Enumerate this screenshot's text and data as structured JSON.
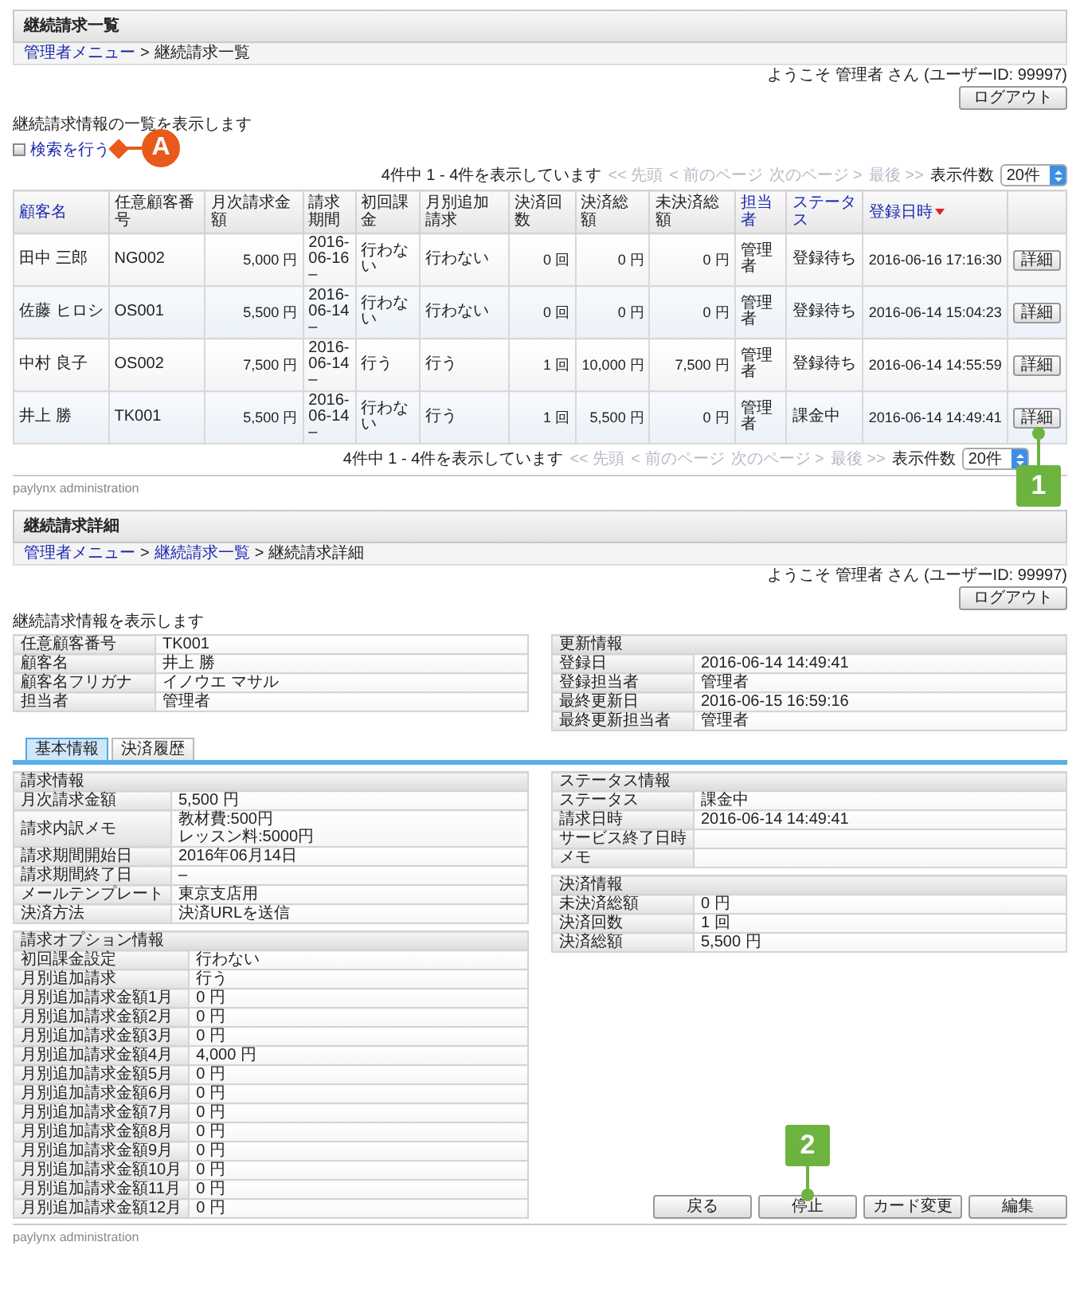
{
  "list_page": {
    "title": "継続請求一覧",
    "separator": ">",
    "breadcrumb": [
      {
        "label": "管理者メニュー",
        "link": true
      },
      {
        "label": "継続請求一覧",
        "link": false
      }
    ],
    "welcome": "ようこそ 管理者 さん (ユーザーID: 99997)",
    "logout": "ログアウト",
    "intro": "継続請求情報の一覧を表示します",
    "search": {
      "label": "検索を行う",
      "annotation": {
        "label": "A",
        "kind": "circle"
      }
    },
    "pagers": [
      {
        "summary": "4件中 1 - 4件を表示しています",
        "links": [
          {
            "label": "<< 先頭",
            "disabled": true
          },
          {
            "label": "< 前のページ",
            "disabled": true
          },
          {
            "label": "次のページ >",
            "disabled": true
          },
          {
            "label": "最後 >>",
            "disabled": true
          }
        ],
        "per_page_label": "表示件数",
        "per_page": "20件"
      },
      {
        "summary": "4件中 1 - 4件を表示しています",
        "links": [
          {
            "label": "<< 先頭",
            "disabled": true
          },
          {
            "label": "< 前のページ",
            "disabled": true
          },
          {
            "label": "次のページ >",
            "disabled": true
          },
          {
            "label": "最後 >>",
            "disabled": true
          }
        ],
        "per_page_label": "表示件数",
        "per_page": "20件"
      }
    ],
    "table": {
      "columns": [
        {
          "label": "顧客名",
          "sortable": true,
          "sorted": false,
          "numeric": false
        },
        {
          "label": "任意顧客番号",
          "sortable": false,
          "sorted": false,
          "numeric": false
        },
        {
          "label": "月次請求金額",
          "sortable": false,
          "sorted": false,
          "numeric": true
        },
        {
          "label": "請求期間",
          "sortable": false,
          "sorted": false,
          "numeric": false
        },
        {
          "label": "初回課金",
          "sortable": false,
          "sorted": false,
          "numeric": false
        },
        {
          "label": "月別追加請求",
          "sortable": false,
          "sorted": false,
          "numeric": false
        },
        {
          "label": "決済回数",
          "sortable": false,
          "sorted": false,
          "numeric": true
        },
        {
          "label": "決済総額",
          "sortable": false,
          "sorted": false,
          "numeric": true
        },
        {
          "label": "未決済総額",
          "sortable": false,
          "sorted": false,
          "numeric": true
        },
        {
          "label": "担当者",
          "sortable": true,
          "sorted": false,
          "numeric": false
        },
        {
          "label": "ステータス",
          "sortable": true,
          "sorted": false,
          "numeric": false
        },
        {
          "label": "登録日時",
          "sortable": true,
          "sorted": true,
          "numeric": false
        }
      ],
      "rows": [
        {
          "cells": [
            "田中 三郎",
            "NG002",
            "5,000 円",
            "2016-06-16 –",
            "行わない",
            "行わない",
            "0 回",
            "0 円",
            "0 円",
            "管理者",
            "登録待ち",
            "2016-06-16 17:16:30"
          ],
          "action": "詳細"
        },
        {
          "cells": [
            "佐藤 ヒロシ",
            "OS001",
            "5,500 円",
            "2016-06-14 –",
            "行わない",
            "行わない",
            "0 回",
            "0 円",
            "0 円",
            "管理者",
            "登録待ち",
            "2016-06-14 15:04:23"
          ],
          "action": "詳細"
        },
        {
          "cells": [
            "中村 良子",
            "OS002",
            "7,500 円",
            "2016-06-14 –",
            "行う",
            "行う",
            "1 回",
            "10,000 円",
            "7,500 円",
            "管理者",
            "登録待ち",
            "2016-06-14 14:55:59"
          ],
          "action": "詳細"
        },
        {
          "cells": [
            "井上 勝",
            "TK001",
            "5,500 円",
            "2016-06-14 –",
            "行わない",
            "行う",
            "1 回",
            "5,500 円",
            "0 円",
            "管理者",
            "課金中",
            "2016-06-14 14:49:41"
          ],
          "action": "詳細"
        }
      ]
    },
    "annotation": {
      "label": "1",
      "kind": "flag"
    },
    "footer": "paylynx administration"
  },
  "detail_page": {
    "title": "継続請求詳細",
    "separator": ">",
    "breadcrumb": [
      {
        "label": "管理者メニュー",
        "link": true
      },
      {
        "label": "継続請求一覧",
        "link": true
      },
      {
        "label": "継続請求詳細",
        "link": false
      }
    ],
    "welcome": "ようこそ 管理者 さん (ユーザーID: 99997)",
    "logout": "ログアウト",
    "intro": "継続請求情報を表示します",
    "customer": {
      "rows": [
        {
          "label": "任意顧客番号",
          "value": "TK001"
        },
        {
          "label": "顧客名",
          "value": "井上 勝"
        },
        {
          "label": "顧客名フリガナ",
          "value": "イノウエ マサル"
        },
        {
          "label": "担当者",
          "value": "管理者"
        }
      ]
    },
    "update_info": {
      "title": "更新情報",
      "rows": [
        {
          "label": "登録日",
          "value": "2016-06-14 14:49:41"
        },
        {
          "label": "登録担当者",
          "value": "管理者"
        },
        {
          "label": "最終更新日",
          "value": "2016-06-15 16:59:16"
        },
        {
          "label": "最終更新担当者",
          "value": "管理者"
        }
      ]
    },
    "tabs": [
      {
        "label": "基本情報",
        "selected": true
      },
      {
        "label": "決済履歴",
        "selected": false
      }
    ],
    "billing": {
      "title": "請求情報",
      "rows": [
        {
          "label": "月次請求金額",
          "value": "5,500 円"
        },
        {
          "label": "請求内訳メモ",
          "lines": [
            "教材費:500円",
            "レッスン料:5000円"
          ]
        },
        {
          "label": "請求期間開始日",
          "value": "2016年06月14日"
        },
        {
          "label": "請求期間終了日",
          "value": "–"
        },
        {
          "label": "メールテンプレート",
          "value": "東京支店用"
        },
        {
          "label": "決済方法",
          "value": "決済URLを送信"
        }
      ]
    },
    "options": {
      "title": "請求オプション情報",
      "rows": [
        {
          "label": "初回課金設定",
          "value": "行わない"
        },
        {
          "label": "月別追加請求",
          "value": "行う"
        },
        {
          "label": "月別追加請求金額1月",
          "value": "0 円"
        },
        {
          "label": "月別追加請求金額2月",
          "value": "0 円"
        },
        {
          "label": "月別追加請求金額3月",
          "value": "0 円"
        },
        {
          "label": "月別追加請求金額4月",
          "value": "4,000 円"
        },
        {
          "label": "月別追加請求金額5月",
          "value": "0 円"
        },
        {
          "label": "月別追加請求金額6月",
          "value": "0 円"
        },
        {
          "label": "月別追加請求金額7月",
          "value": "0 円"
        },
        {
          "label": "月別追加請求金額8月",
          "value": "0 円"
        },
        {
          "label": "月別追加請求金額9月",
          "value": "0 円"
        },
        {
          "label": "月別追加請求金額10月",
          "value": "0 円"
        },
        {
          "label": "月別追加請求金額11月",
          "value": "0 円"
        },
        {
          "label": "月別追加請求金額12月",
          "value": "0 円"
        }
      ]
    },
    "status": {
      "title": "ステータス情報",
      "rows": [
        {
          "label": "ステータス",
          "value": "課金中"
        },
        {
          "label": "請求日時",
          "value": "2016-06-14 14:49:41"
        },
        {
          "label": "サービス終了日時"
        },
        {
          "label": "メモ"
        }
      ]
    },
    "payment": {
      "title": "決済情報",
      "rows": [
        {
          "label": "未決済総額",
          "value": "0 円"
        },
        {
          "label": "決済回数",
          "value": "1 回"
        },
        {
          "label": "決済総額",
          "value": "5,500 円"
        }
      ]
    },
    "buttons": [
      "戻る",
      "停止",
      "カード変更",
      "編集"
    ],
    "annotation": {
      "label": "2",
      "kind": "flag"
    },
    "footer": "paylynx administration"
  }
}
